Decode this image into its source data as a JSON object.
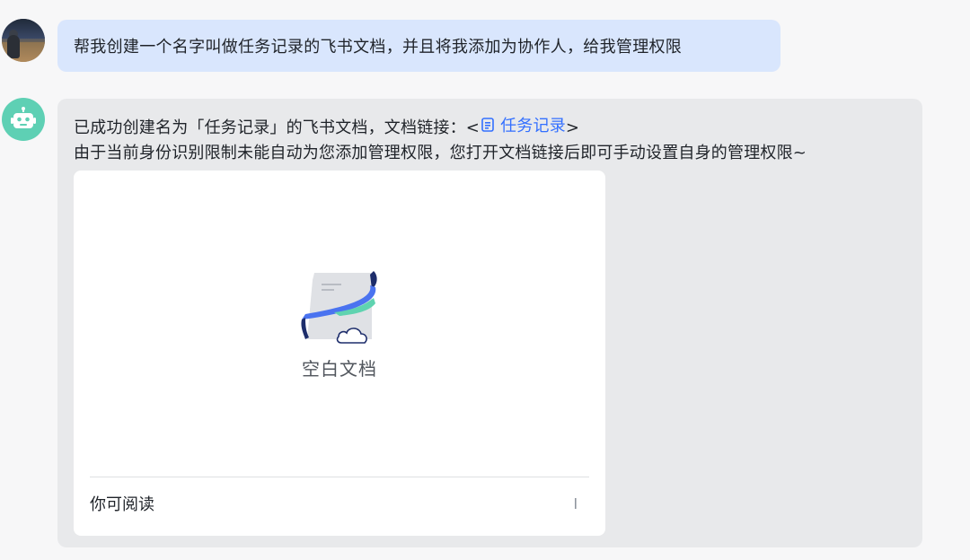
{
  "user_message": {
    "text": "帮我创建一个名字叫做任务记录的飞书文档，并且将我添加为协作人，给我管理权限"
  },
  "bot_message": {
    "line1_prefix": "已成功创建名为「任务记录」的飞书文档，文档链接：<",
    "link_icon": "doc-icon",
    "link_text": "任务记录",
    "line1_suffix": ">",
    "line2": "由于当前身份识别限制未能自动为您添加管理权限，您打开文档链接后即可手动设置自身的管理权限~"
  },
  "doc_card": {
    "title": "空白文档",
    "permission": "你可阅读"
  },
  "colors": {
    "user_bubble": "#d9e6fd",
    "bot_bubble": "#e8e9eb",
    "link": "#3370ff",
    "bot_avatar": "#5ed0b4"
  }
}
